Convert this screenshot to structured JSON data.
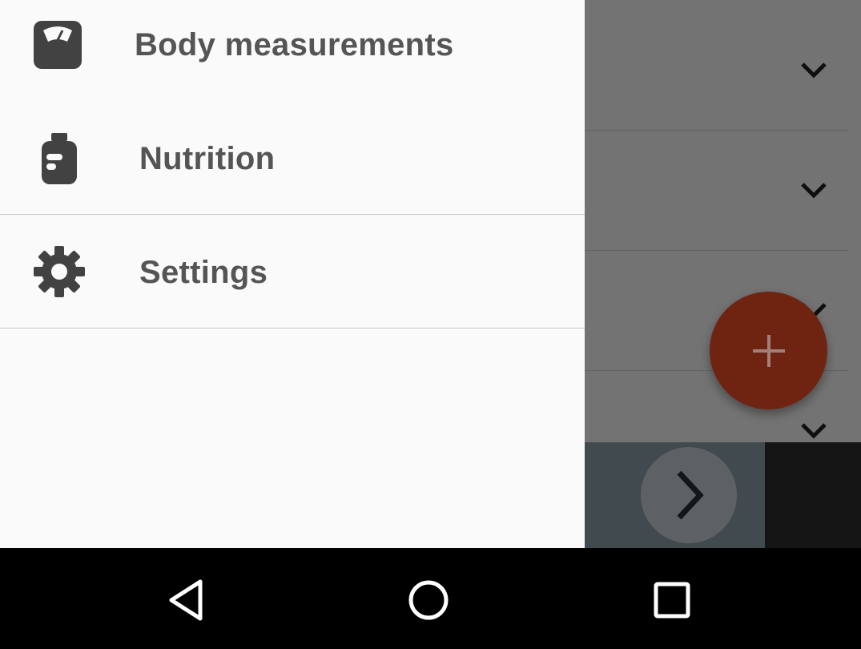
{
  "drawer": {
    "items": [
      {
        "label": "Body measurements",
        "icon": "scale-icon"
      },
      {
        "label": "Nutrition",
        "icon": "supplement-jar-icon"
      },
      {
        "label": "Settings",
        "icon": "gear-icon"
      }
    ]
  },
  "background": {
    "fab_icon": "plus-icon",
    "next_icon": "chevron-right-icon",
    "row_icon": "chevron-down-icon"
  },
  "system_nav": {
    "buttons": [
      "back-icon",
      "home-icon",
      "recents-icon"
    ]
  },
  "colors": {
    "drawer_bg": "#fafafa",
    "drawer_text": "#555555",
    "icon": "#424242",
    "fab": "#6f2412",
    "navbar": "#000000"
  }
}
